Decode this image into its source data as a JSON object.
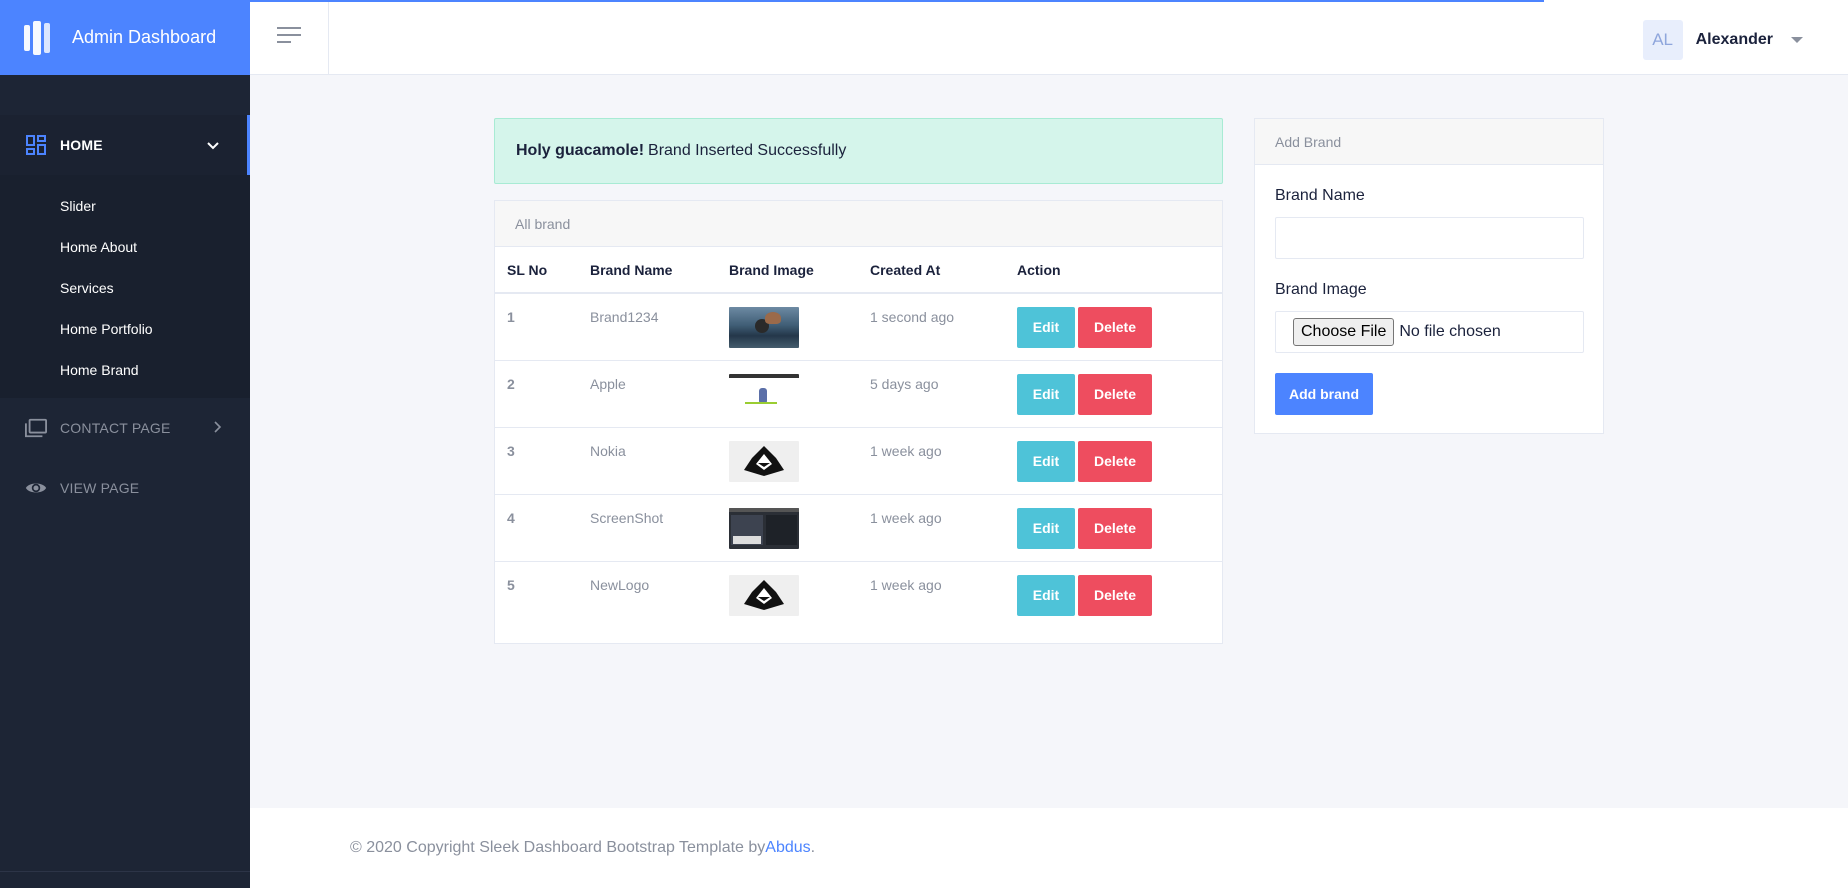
{
  "app": {
    "title": "Admin Dashboard"
  },
  "sidebar": {
    "home": {
      "label": "HOME",
      "icon": "dashboard-icon"
    },
    "home_items": [
      "Slider",
      "Home About",
      "Services",
      "Home Portfolio",
      "Home Brand"
    ],
    "contact": {
      "label": "CONTACT PAGE",
      "icon": "folder-multiple-icon"
    },
    "view": {
      "label": "VIEW PAGE",
      "icon": "eye-icon"
    }
  },
  "header": {
    "user_initials": "AL",
    "user_name": "Alexander"
  },
  "alert": {
    "strong": "Holy guacamole!",
    "message": "Brand Inserted Successfully"
  },
  "brand_table": {
    "title": "All brand",
    "columns": [
      "SL No",
      "Brand Name",
      "Brand Image",
      "Created At",
      "Action"
    ],
    "rows": [
      {
        "sl": "1",
        "name": "Brand1234",
        "image": "landscape-thumbnail",
        "created": "1 second ago"
      },
      {
        "sl": "2",
        "name": "Apple",
        "image": "figure-thumbnail",
        "created": "5 days ago"
      },
      {
        "sl": "3",
        "name": "Nokia",
        "image": "hooded-logo-thumbnail",
        "created": "1 week ago"
      },
      {
        "sl": "4",
        "name": "ScreenShot",
        "image": "screenshot-thumbnail",
        "created": "1 week ago"
      },
      {
        "sl": "5",
        "name": "NewLogo",
        "image": "hooded-logo-thumbnail",
        "created": "1 week ago"
      }
    ],
    "edit_label": "Edit",
    "delete_label": "Delete"
  },
  "add_brand": {
    "title": "Add Brand",
    "name_label": "Brand Name",
    "name_value": "",
    "image_label": "Brand Image",
    "file_button": "Choose File",
    "file_status": "No file chosen",
    "submit_label": "Add brand"
  },
  "footer": {
    "text": "© 2020 Copyright Sleek Dashboard Bootstrap Template by ",
    "author": "Abdus",
    "suffix": "."
  },
  "colors": {
    "primary": "#4c84ff",
    "sidebar": "#1d2535",
    "info": "#4ec3d8",
    "danger": "#ee4d5f",
    "success_bg": "#d5f5eb"
  }
}
